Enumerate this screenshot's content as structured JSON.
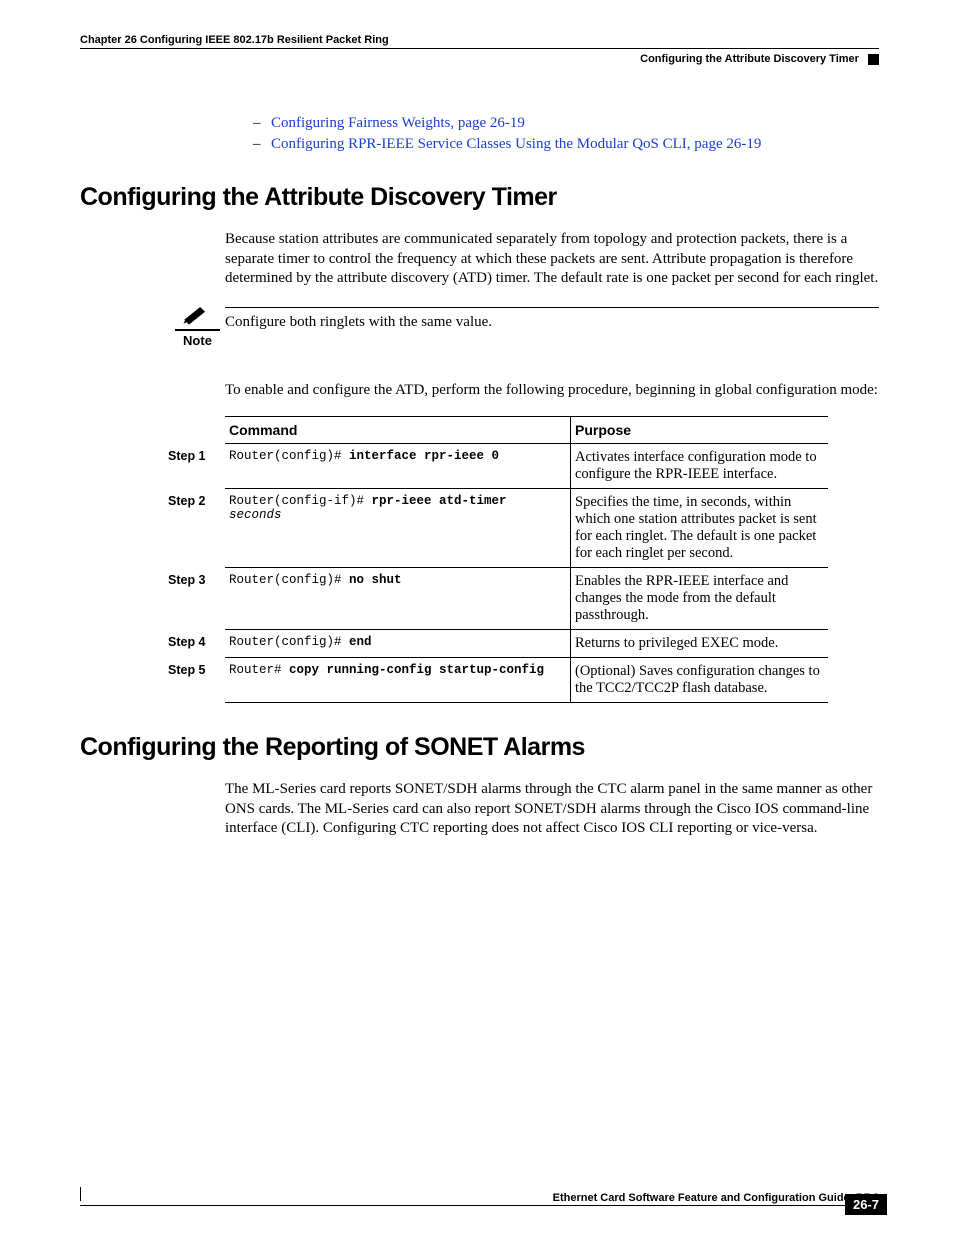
{
  "header": {
    "chapter_line": "Chapter 26    Configuring IEEE 802.17b Resilient Packet Ring",
    "section_line": "Configuring the Attribute Discovery Timer"
  },
  "bullets": [
    "Configuring Fairness Weights, page 26-19",
    "Configuring RPR-IEEE Service Classes Using the Modular QoS CLI, page 26-19"
  ],
  "section1": {
    "title": "Configuring the Attribute Discovery Timer",
    "para1": "Because station attributes are communicated separately from topology and protection packets, there is a separate timer to control the frequency at which these packets are sent. Attribute propagation is therefore determined by the attribute discovery (ATD) timer. The default rate is one packet per second for each ringlet.",
    "note_label": "Note",
    "note_text": "Configure both ringlets with the same value.",
    "para2": "To enable and configure the ATD, perform the following procedure, beginning in global configuration mode:"
  },
  "table": {
    "head_command": "Command",
    "head_purpose": "Purpose",
    "rows": [
      {
        "step": "Step 1",
        "prompt": "Router(config)# ",
        "cmd_bold": "interface rpr-ieee 0",
        "cmd_ital": "",
        "purpose": "Activates interface configuration mode to configure the RPR-IEEE interface."
      },
      {
        "step": "Step 2",
        "prompt": "Router(config-if)# ",
        "cmd_bold": "rpr-ieee atd-timer",
        "cmd_ital": "seconds",
        "purpose": "Specifies the time, in seconds, within which one station attributes packet is sent for each ringlet. The default is one packet for each ringlet per second."
      },
      {
        "step": "Step 3",
        "prompt": "Router(config)# ",
        "cmd_bold": "no shut",
        "cmd_ital": "",
        "purpose": "Enables the RPR-IEEE interface and changes the mode from the default passthrough."
      },
      {
        "step": "Step 4",
        "prompt": "Router(config)# ",
        "cmd_bold": "end",
        "cmd_ital": "",
        "purpose": "Returns to privileged EXEC mode."
      },
      {
        "step": "Step 5",
        "prompt": "Router# ",
        "cmd_bold": "copy running-config startup-config",
        "cmd_ital": "",
        "purpose": "(Optional) Saves configuration changes to the TCC2/TCC2P flash database."
      }
    ]
  },
  "section2": {
    "title": "Configuring the Reporting of SONET Alarms",
    "para1": "The ML-Series card reports SONET/SDH alarms through the CTC alarm panel in the same manner as other ONS cards. The ML-Series card can also report SONET/SDH alarms through the Cisco IOS command-line interface (CLI). Configuring CTC reporting does not affect Cisco IOS CLI reporting or vice-versa."
  },
  "footer": {
    "doc_title": "Ethernet Card Software Feature and Configuration Guide, R7.2",
    "page_number": "26-7"
  }
}
